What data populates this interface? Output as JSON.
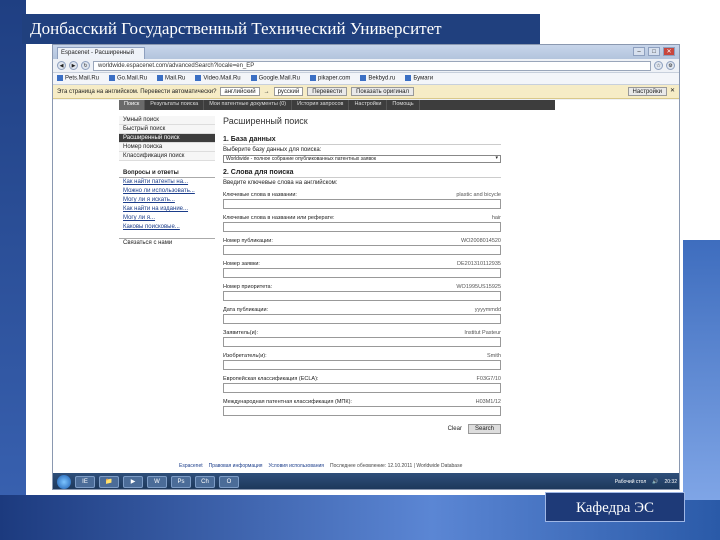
{
  "slide": {
    "title": "Донбасский Государственный Технический Университет",
    "department": "Кафедра ЭС"
  },
  "browser": {
    "tab_label": "Espacenet - Расширенный",
    "url": "worldwide.espacenet.com/advancedSearch?locale=en_EP",
    "bookmarks": [
      "Pets.Mail.Ru",
      "Go.Mail.Ru",
      "Mail.Ru",
      "Video.Mail.Ru",
      "Google.Mail.Ru",
      "pikaper.com",
      "Bekbyd.ru",
      "Бумаги"
    ],
    "translate": {
      "text": "Эта страница на английском. Перевести автоматически?",
      "from": "английский",
      "to": "русский",
      "translate_btn": "Перевести",
      "show_original": "Показать оригинал",
      "settings": "Настройки"
    }
  },
  "espacenet": {
    "topnav": [
      "Поиск",
      "Результаты поиска",
      "Мои патентные документы (0)",
      "История запросов",
      "Настройки",
      "Помощь"
    ],
    "sidebar": {
      "items": [
        "Умный поиск",
        "Быстрый поиск",
        "Расширенный поиск",
        "Номер поиска",
        "Классификация поиск"
      ],
      "active_index": 2,
      "faq_title": "Вопросы и ответы",
      "faq": [
        "Как найти патенты на...",
        "Можно ли использовать...",
        "Могу ли я искать...",
        "Как найти на издание...",
        "Могу ли я...",
        "Каковы поисковые..."
      ],
      "footer": "Связаться с нами"
    },
    "main": {
      "title": "Расширенный поиск",
      "section1": "1. База данных",
      "section1_text": "Выберите базу данных для поиска:",
      "database_value": "Worldwide - полное собрание опубликованных патентных заявок",
      "section2": "2. Слова для поиска",
      "section2_text": "Введите ключевые слова на английском:",
      "fields": [
        {
          "label": "Ключевые слова в названии:",
          "hint": "plastic and bicycle"
        },
        {
          "label": "Ключевые слова в названии или реферате:",
          "hint": "hair"
        },
        {
          "label": "Номер публикации:",
          "hint": "WO2008014520"
        },
        {
          "label": "Номер заявки:",
          "hint": "DE201310112935"
        },
        {
          "label": "Номер приоритета:",
          "hint": "WO1995US15925"
        },
        {
          "label": "Дата публикации:",
          "hint": "yyyymmdd"
        },
        {
          "label": "Заявитель(и):",
          "hint": "Institut Pasteur"
        },
        {
          "label": "Изобретатель(и):",
          "hint": "Smith"
        },
        {
          "label": "Европейская классификация (ECLA):",
          "hint": "F03G7/10"
        },
        {
          "label": "Международная патентная классификация (МПК):",
          "hint": "H03M1/12"
        }
      ],
      "clear_label": "Clear",
      "search_label": "Search"
    },
    "footer": {
      "links": [
        "Espacenet",
        "Правовая информация",
        "Условия использования"
      ],
      "status": "Последнее обновление: 12.10.2011 | Worldwide Database"
    }
  },
  "taskbar": {
    "apps": [
      "IE",
      "📁",
      "▶",
      "W",
      "Ps",
      "Ch",
      "O"
    ],
    "tray_text": "Рабочий стол",
    "time": "20:32"
  }
}
